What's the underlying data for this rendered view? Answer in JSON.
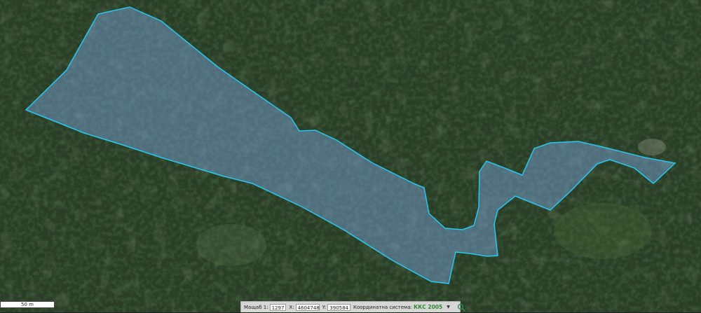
{
  "map": {
    "background": "satellite-forest-imagery",
    "parcel_fill": "#7fa8e6",
    "parcel_stroke": "#27c8f2"
  },
  "scale_bar": {
    "label": "50 m"
  },
  "status_bar": {
    "scale_label": "Мащаб 1:",
    "scale_value": "1297",
    "x_label": "X:",
    "x_value": "4604748",
    "y_label": "Y:",
    "y_value": "390584",
    "crs_label": "Координатна система:",
    "crs_value": "ККС 2005",
    "dropdown_icon": "chevron-down-icon",
    "search_icon": "search-icon"
  }
}
